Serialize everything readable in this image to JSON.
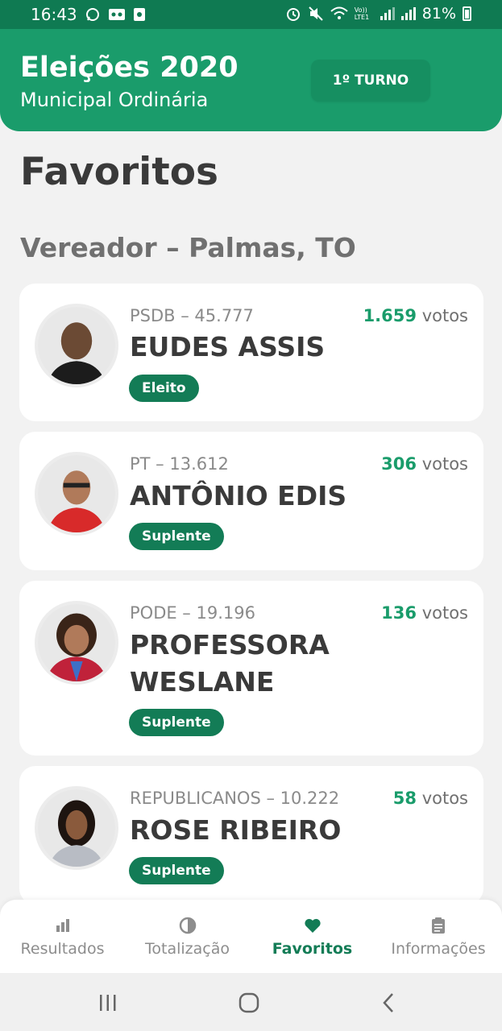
{
  "status_bar": {
    "time": "16:43",
    "battery": "81%",
    "lte_label": "Vo)) LTE1"
  },
  "header": {
    "title": "Eleições 2020",
    "subtitle": "Municipal Ordinária",
    "turno_button": "1º TURNO"
  },
  "page_title": "Favoritos",
  "section_title": "Vereador – Palmas, TO",
  "votes_suffix": "votos",
  "candidates": [
    {
      "party": "PSDB – 45.777",
      "votes": "1.659",
      "name": "EUDES ASSIS",
      "status": "Eleito"
    },
    {
      "party": "PT – 13.612",
      "votes": "306",
      "name": "ANTÔNIO EDIS",
      "status": "Suplente"
    },
    {
      "party": "PODE – 19.196",
      "votes": "136",
      "name": "PROFESSORA WESLANE",
      "status": "Suplente"
    },
    {
      "party": "REPUBLICANOS – 10.222",
      "votes": "58",
      "name": "ROSE RIBEIRO",
      "status": "Suplente"
    }
  ],
  "bottom_nav": {
    "items": [
      {
        "label": "Resultados",
        "icon": "bar-chart-icon"
      },
      {
        "label": "Totalização",
        "icon": "pie-chart-icon"
      },
      {
        "label": "Favoritos",
        "icon": "heart-icon",
        "active": true
      },
      {
        "label": "Informações",
        "icon": "clipboard-icon"
      }
    ]
  },
  "colors": {
    "primary": "#1a9c6b",
    "primary_dark": "#137c56",
    "status_bar": "#0f7a52",
    "background": "#f2f2f2"
  }
}
